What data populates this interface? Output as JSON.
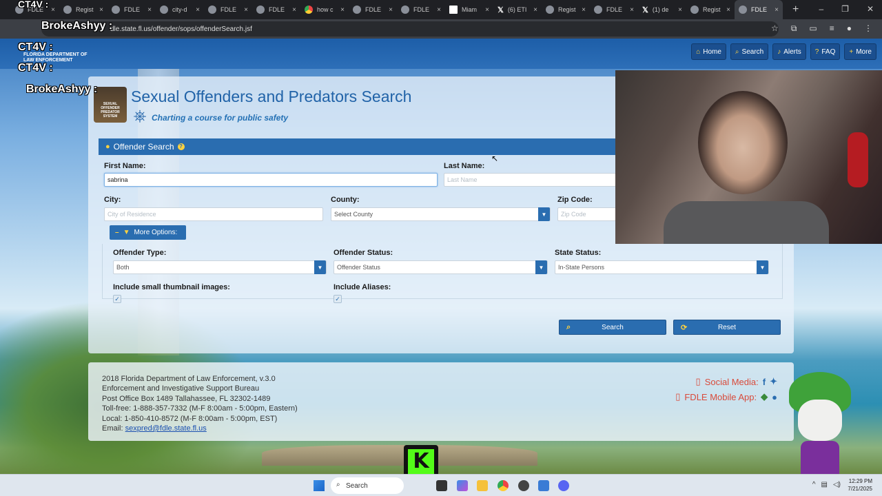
{
  "browser": {
    "tabs": [
      {
        "label": "FDLE",
        "icon": "globe-icon"
      },
      {
        "label": "Regist",
        "icon": "globe-icon"
      },
      {
        "label": "FDLE",
        "icon": "globe-icon"
      },
      {
        "label": "city-d",
        "icon": "globe-icon"
      },
      {
        "label": "FDLE",
        "icon": "globe-icon"
      },
      {
        "label": "FDLE",
        "icon": "globe-icon"
      },
      {
        "label": "how c",
        "icon": "chrome-icon"
      },
      {
        "label": "FDLE",
        "icon": "globe-icon"
      },
      {
        "label": "FDLE",
        "icon": "globe-icon"
      },
      {
        "label": "Miam",
        "icon": "news-icon"
      },
      {
        "label": "(6) ETI",
        "icon": "x-icon"
      },
      {
        "label": "Regist",
        "icon": "globe-icon"
      },
      {
        "label": "FDLE",
        "icon": "globe-icon"
      },
      {
        "label": "(1) de",
        "icon": "x-icon"
      },
      {
        "label": "Regist",
        "icon": "globe-icon"
      },
      {
        "label": "FDLE",
        "icon": "globe-icon",
        "active": true
      }
    ],
    "new_tab": "+",
    "url": "offender.fdle.state.fl.us/offender/sops/offenderSearch.jsf",
    "url_visible": "dle.state.fl.us/offender/sops/offenderSearch.jsf"
  },
  "nav": {
    "buttons": [
      {
        "label": "Home",
        "icon": "home-icon",
        "glyph": "⌂"
      },
      {
        "label": "Search",
        "icon": "search-icon",
        "glyph": "⌕"
      },
      {
        "label": "Alerts",
        "icon": "bell-icon",
        "glyph": "♪"
      },
      {
        "label": "FAQ",
        "icon": "question-icon",
        "glyph": "?"
      },
      {
        "label": "More",
        "icon": "plus-icon",
        "glyph": "+"
      }
    ]
  },
  "logo_small": {
    "line1": "FLORIDA DEPARTMENT OF",
    "line2": "LAW ENFORCEMENT"
  },
  "header": {
    "seal_text": "SEXUAL OFFENDER PREDATOR SYSTEM",
    "title": "Sexual Offenders and Predators Search",
    "tagline": "Charting a course for public safety"
  },
  "search_panel": {
    "title": "Offender Search",
    "help": "?",
    "first_name_label": "First Name:",
    "first_name_value": "sabrina",
    "last_name_label": "Last Name:",
    "last_name_placeholder": "Last Name",
    "city_label": "City:",
    "city_placeholder": "City of Residence",
    "county_label": "County:",
    "county_value": "Select County",
    "zip_label": "Zip Code:",
    "zip_placeholder": "Zip Code",
    "more_options_label": "More Options:",
    "offender_type_label": "Offender Type:",
    "offender_type_value": "Both",
    "offender_status_label": "Offender Status:",
    "offender_status_value": "Offender Status",
    "state_status_label": "State Status:",
    "state_status_value": "In-State Persons",
    "thumbnails_label": "Include small thumbnail images:",
    "thumbnails_checked": true,
    "aliases_label": "Include Aliases:",
    "aliases_checked": true,
    "search_button": "Search",
    "reset_button": "Reset"
  },
  "footer": {
    "lines": [
      "2018 Florida Department of Law Enforcement, v.3.0",
      "Enforcement and Investigative Support Bureau",
      "Post Office Box 1489 Tallahassee, FL 32302-1489",
      "Toll-free: 1-888-357-7332 (M-F 8:00am - 5:00pm, Eastern)",
      "Local: 1-850-410-8572 (M-F 8:00am - 5:00pm, EST)"
    ],
    "email_label": "Email:",
    "email": "sexpred@fdle.state.fl.us",
    "social_label": "Social Media:",
    "mobile_label": "FDLE Mobile App:"
  },
  "overlay": {
    "chat_names": [
      "CT4V :",
      "BrokeAshyy :",
      "CT4V :",
      "CT4V :",
      "BrokeAshyy :"
    ],
    "kick_letter": "K"
  },
  "taskbar": {
    "search_label": "Search",
    "time": "12:29 PM",
    "date": "7/21/2025"
  },
  "colors": {
    "accent": "#2a6db0",
    "title_blue": "#2163a8",
    "icon_yellow": "#ffd23f",
    "kick_green": "#53fc18"
  }
}
